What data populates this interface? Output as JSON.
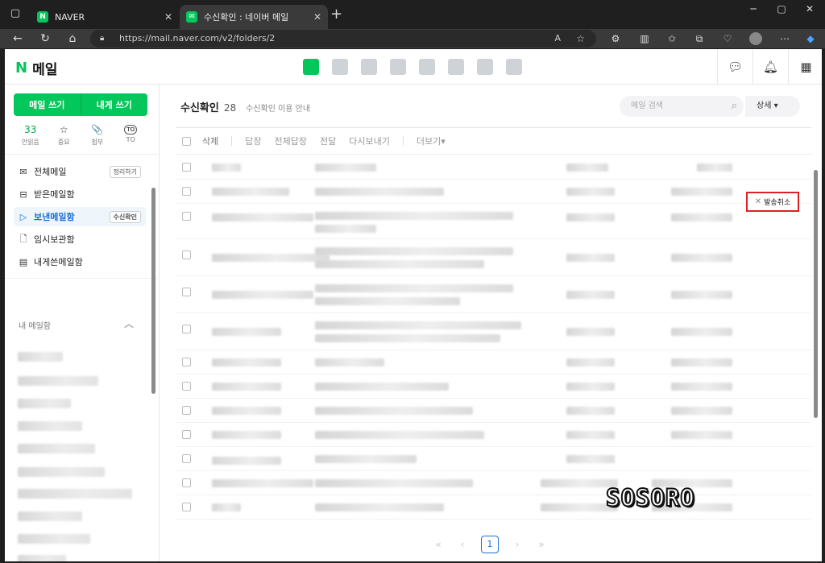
{
  "browser": {
    "tabs": [
      {
        "title": "NAVER",
        "favicon": "N",
        "active": false
      },
      {
        "title": "수신확인 : 네이버 메일",
        "favicon": "mail",
        "active": true
      }
    ],
    "url": "https://mail.naver.com/v2/folders/2"
  },
  "header": {
    "logo_mark": "N",
    "logo_text": "메일"
  },
  "sidebar": {
    "compose_label": "메일 쓰기",
    "self_compose_label": "내게 쓰기",
    "quick": [
      {
        "top": "33",
        "label": "안읽음"
      },
      {
        "top": "☆",
        "label": "중요"
      },
      {
        "top": "📎",
        "label": "첨부"
      },
      {
        "top": "TO",
        "label": "TO"
      }
    ],
    "folders": [
      {
        "label": "전체메일",
        "tag": "정리하기",
        "selected": false,
        "icon": "mail-icon"
      },
      {
        "label": "받은메일함",
        "tag": "",
        "selected": false,
        "icon": "inbox-icon"
      },
      {
        "label": "보낸메일함",
        "tag": "수신확인",
        "selected": true,
        "icon": "send-icon"
      },
      {
        "label": "임시보관함",
        "tag": "",
        "selected": false,
        "icon": "draft-icon"
      },
      {
        "label": "내게쓴메일함",
        "tag": "",
        "selected": false,
        "icon": "note-icon"
      }
    ],
    "my_mailbox_label": "내 메일함"
  },
  "main": {
    "folder_title": "수신확인",
    "folder_count": "28",
    "folder_guide": "수신확인 이용 안내",
    "search_placeholder": "메일 검색",
    "detail_label": "상세 ▾",
    "toolbar": {
      "delete": "삭제",
      "reply": "답장",
      "reply_all": "전체답장",
      "forward": "전달",
      "resend": "다시보내기",
      "more": "더보기▾"
    },
    "cancel_send_label": "발송취소",
    "pagination": {
      "current": "1"
    }
  },
  "watermark": "SOSORO",
  "colors": {
    "brand": "#03c75a",
    "selected": "#1a6fd4",
    "highlight_border": "#e02020"
  }
}
